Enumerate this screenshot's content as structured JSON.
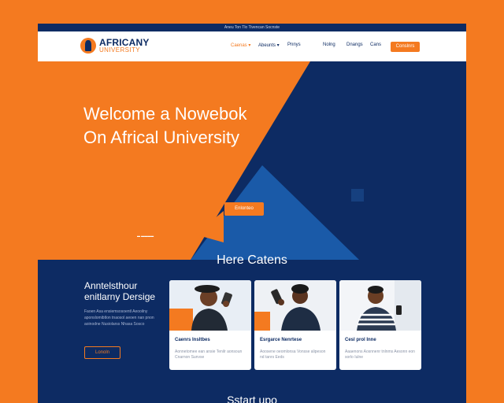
{
  "topbar": {
    "text": "Aneu Ton Tlo Tivencan Socnste"
  },
  "brand": {
    "name_line1": "AFRICANY",
    "name_line2": "UNIVERSITY"
  },
  "nav": {
    "links": [
      "Caenas ▾",
      "Abeunts ▾",
      "Pnnys",
      "Nolng",
      "Dnangs",
      "Cans"
    ],
    "cta_label": "Conslnrs"
  },
  "hero": {
    "title_line1": "Welcome a Nowebok",
    "title_line2": "On Africal University",
    "button_label": "Enlonteo",
    "dot_indicator": "▬ ▬▬▬▬"
  },
  "section": {
    "title": "Here Catens"
  },
  "about": {
    "heading_line1": "Anntelsthour",
    "heading_line2": "enitlarny Dersige",
    "text": "Faoen Asa ensiemsosoentl Aeooilny aponslomibtlon tnaosol aeoen nan pnon aoinodne Nusiolarss Nhasa Sosco",
    "button_label": "Lonoln"
  },
  "cards": [
    {
      "title": "Caenrs Insltbes",
      "text": "Aonnetomee ean ansie Tenilr aonsoun Cnarnon Sunvse"
    },
    {
      "title": "Esrgarce Nenrtese",
      "text": "Aoosene oeomlonsa Vonsse alipeson nd tanrs Eeds"
    },
    {
      "title": "Cesl prol Inne",
      "text": "Aaaenons Aosnnenr tnlnms Aesonn eon sorlo Iulne"
    }
  ],
  "footer": {
    "peek_title": "Sstart upo"
  },
  "colors": {
    "orange": "#f47a20",
    "navy": "#0d2b63",
    "blue": "#1a5aa8"
  }
}
